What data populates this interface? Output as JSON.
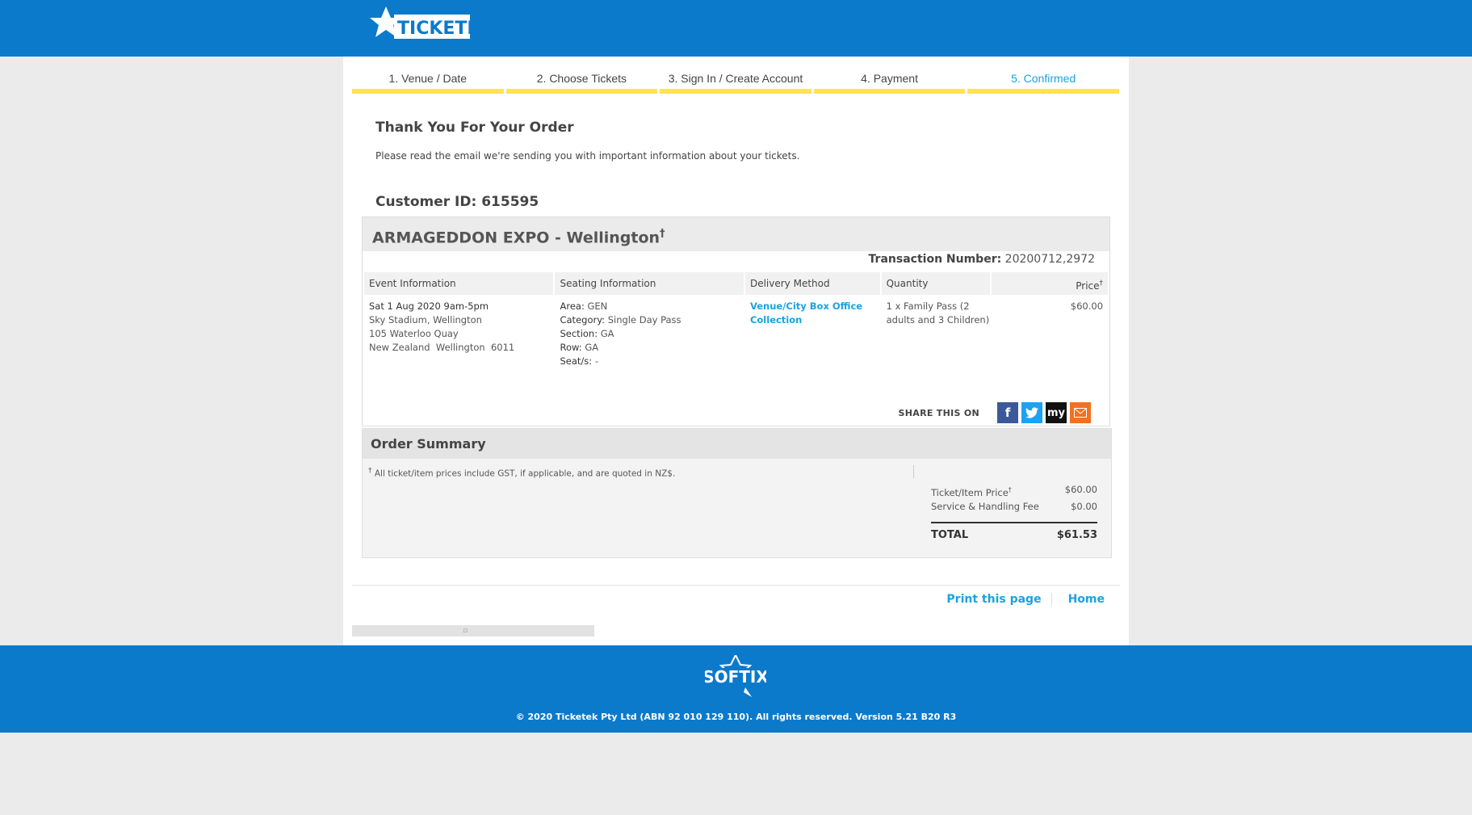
{
  "header": {
    "brand": "TICKETEK"
  },
  "steps": [
    {
      "label": "1. Venue / Date"
    },
    {
      "label": "2. Choose Tickets"
    },
    {
      "label": "3. Sign In / Create Account"
    },
    {
      "label": "4. Payment"
    },
    {
      "label": "5. Confirmed"
    }
  ],
  "confirmation": {
    "title": "Thank You For Your Order",
    "message": "Please read the email we're sending you with important information about your tickets.",
    "customer_id": "Customer ID: 615595"
  },
  "event": {
    "title": "ARMAGEDDON EXPO - Wellington",
    "title_mark": "†",
    "transaction_label": "Transaction Number:",
    "transaction_number": "20200712,2972",
    "columns": {
      "event_info": "Event Information",
      "seating_info": "Seating Information",
      "delivery": "Delivery Method",
      "quantity": "Quantity",
      "price": "Price",
      "price_mark": "†"
    },
    "row": {
      "datetime": "Sat 1 Aug 2020 9am-5pm",
      "venue": "Sky Stadium, Wellington",
      "address1": "105 Waterloo Quay",
      "address2": "New Zealand  Wellington  6011",
      "area_label": "Area:",
      "area": "GEN",
      "category_label": "Category:",
      "category": "Single Day Pass",
      "section_label": "Section:",
      "section": "GA",
      "row_label": "Row:",
      "row": "GA",
      "seats_label": "Seat/s:",
      "seats": "-",
      "delivery": "Venue/City Box Office Collection",
      "quantity": "1 x Family Pass (2 adults and 3 Children)",
      "price": "$60.00"
    },
    "share_label": "SHARE THIS ON",
    "share_icons": [
      "facebook-icon",
      "twitter-icon",
      "myspace-icon",
      "email-icon"
    ]
  },
  "summary": {
    "title": "Order Summary",
    "note_mark": "†",
    "note": "All ticket/item prices include GST, if applicable, and are quoted in NZ$.",
    "ticket_price_label": "Ticket/Item Price",
    "ticket_price_mark": "†",
    "ticket_price": "$60.00",
    "fee_label": "Service & Handling Fee",
    "fee": "$0.00",
    "total_label": "TOTAL",
    "total": "$61.53"
  },
  "footer_links": {
    "print": "Print this page",
    "home": "Home"
  },
  "footer": {
    "brand": "SOFTIX",
    "copyright": "© 2020 Ticketek Pty Ltd (ABN 92 010 129 110). All rights reserved. Version 5.21 B20 R3"
  },
  "colors": {
    "brand_blue": "#0b7acb",
    "accent_yellow": "#ffe44d",
    "link_blue": "#1aa3e0"
  }
}
